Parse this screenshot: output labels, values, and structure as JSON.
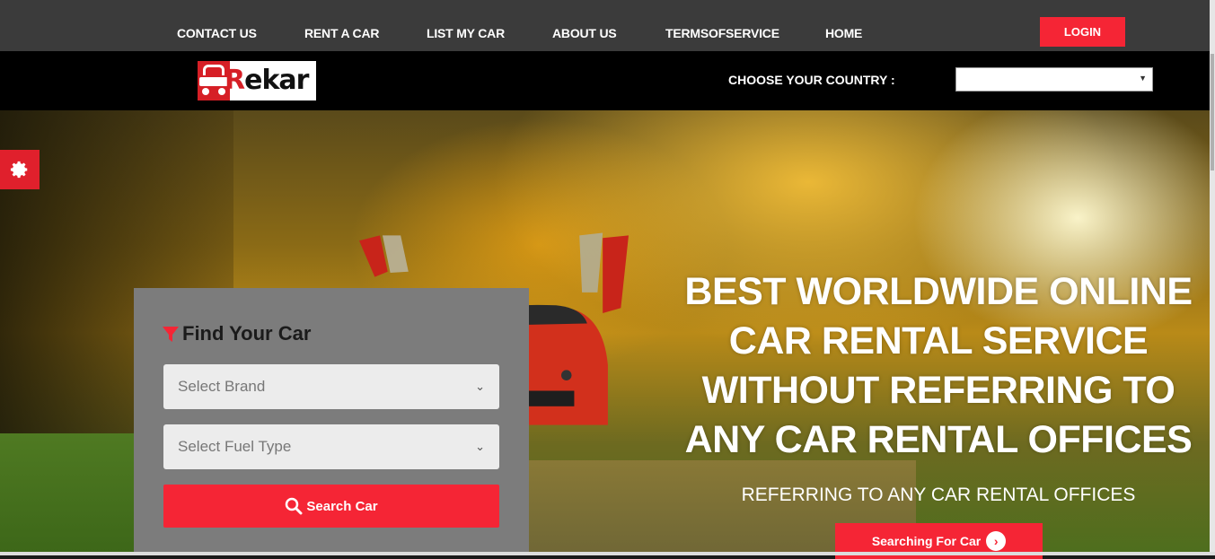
{
  "topnav": {
    "items": [
      "CONTACT US",
      "RENT A CAR",
      "LIST MY CAR",
      "ABOUT US",
      "TERMSOFSERVICE",
      "HOME"
    ],
    "login": "LOGIN"
  },
  "header": {
    "logo_text_r": "R",
    "logo_text_rest": "ekar",
    "country_label": "CHOOSE YOUR COUNTRY :",
    "country_value": ""
  },
  "find": {
    "title": "Find Your Car",
    "brand_placeholder": "Select Brand",
    "fuel_placeholder": "Select Fuel Type",
    "search_label": "Search Car"
  },
  "hero": {
    "headline": "BEST WORLDWIDE ONLINE CAR RENTAL SERVICE WITHOUT REFERRING TO ANY CAR RENTAL OFFICES",
    "subline": "REFERRING TO ANY CAR RENTAL OFFICES",
    "cta_label": "Searching For Car"
  },
  "icons": [
    "gear-icon",
    "filter-icon",
    "search-icon",
    "chevron-right-icon",
    "chevron-down-icon"
  ],
  "colors": {
    "accent": "#f52535",
    "topbar": "#3b3b3b",
    "header": "#000000",
    "panel": "#7c7c7c"
  }
}
